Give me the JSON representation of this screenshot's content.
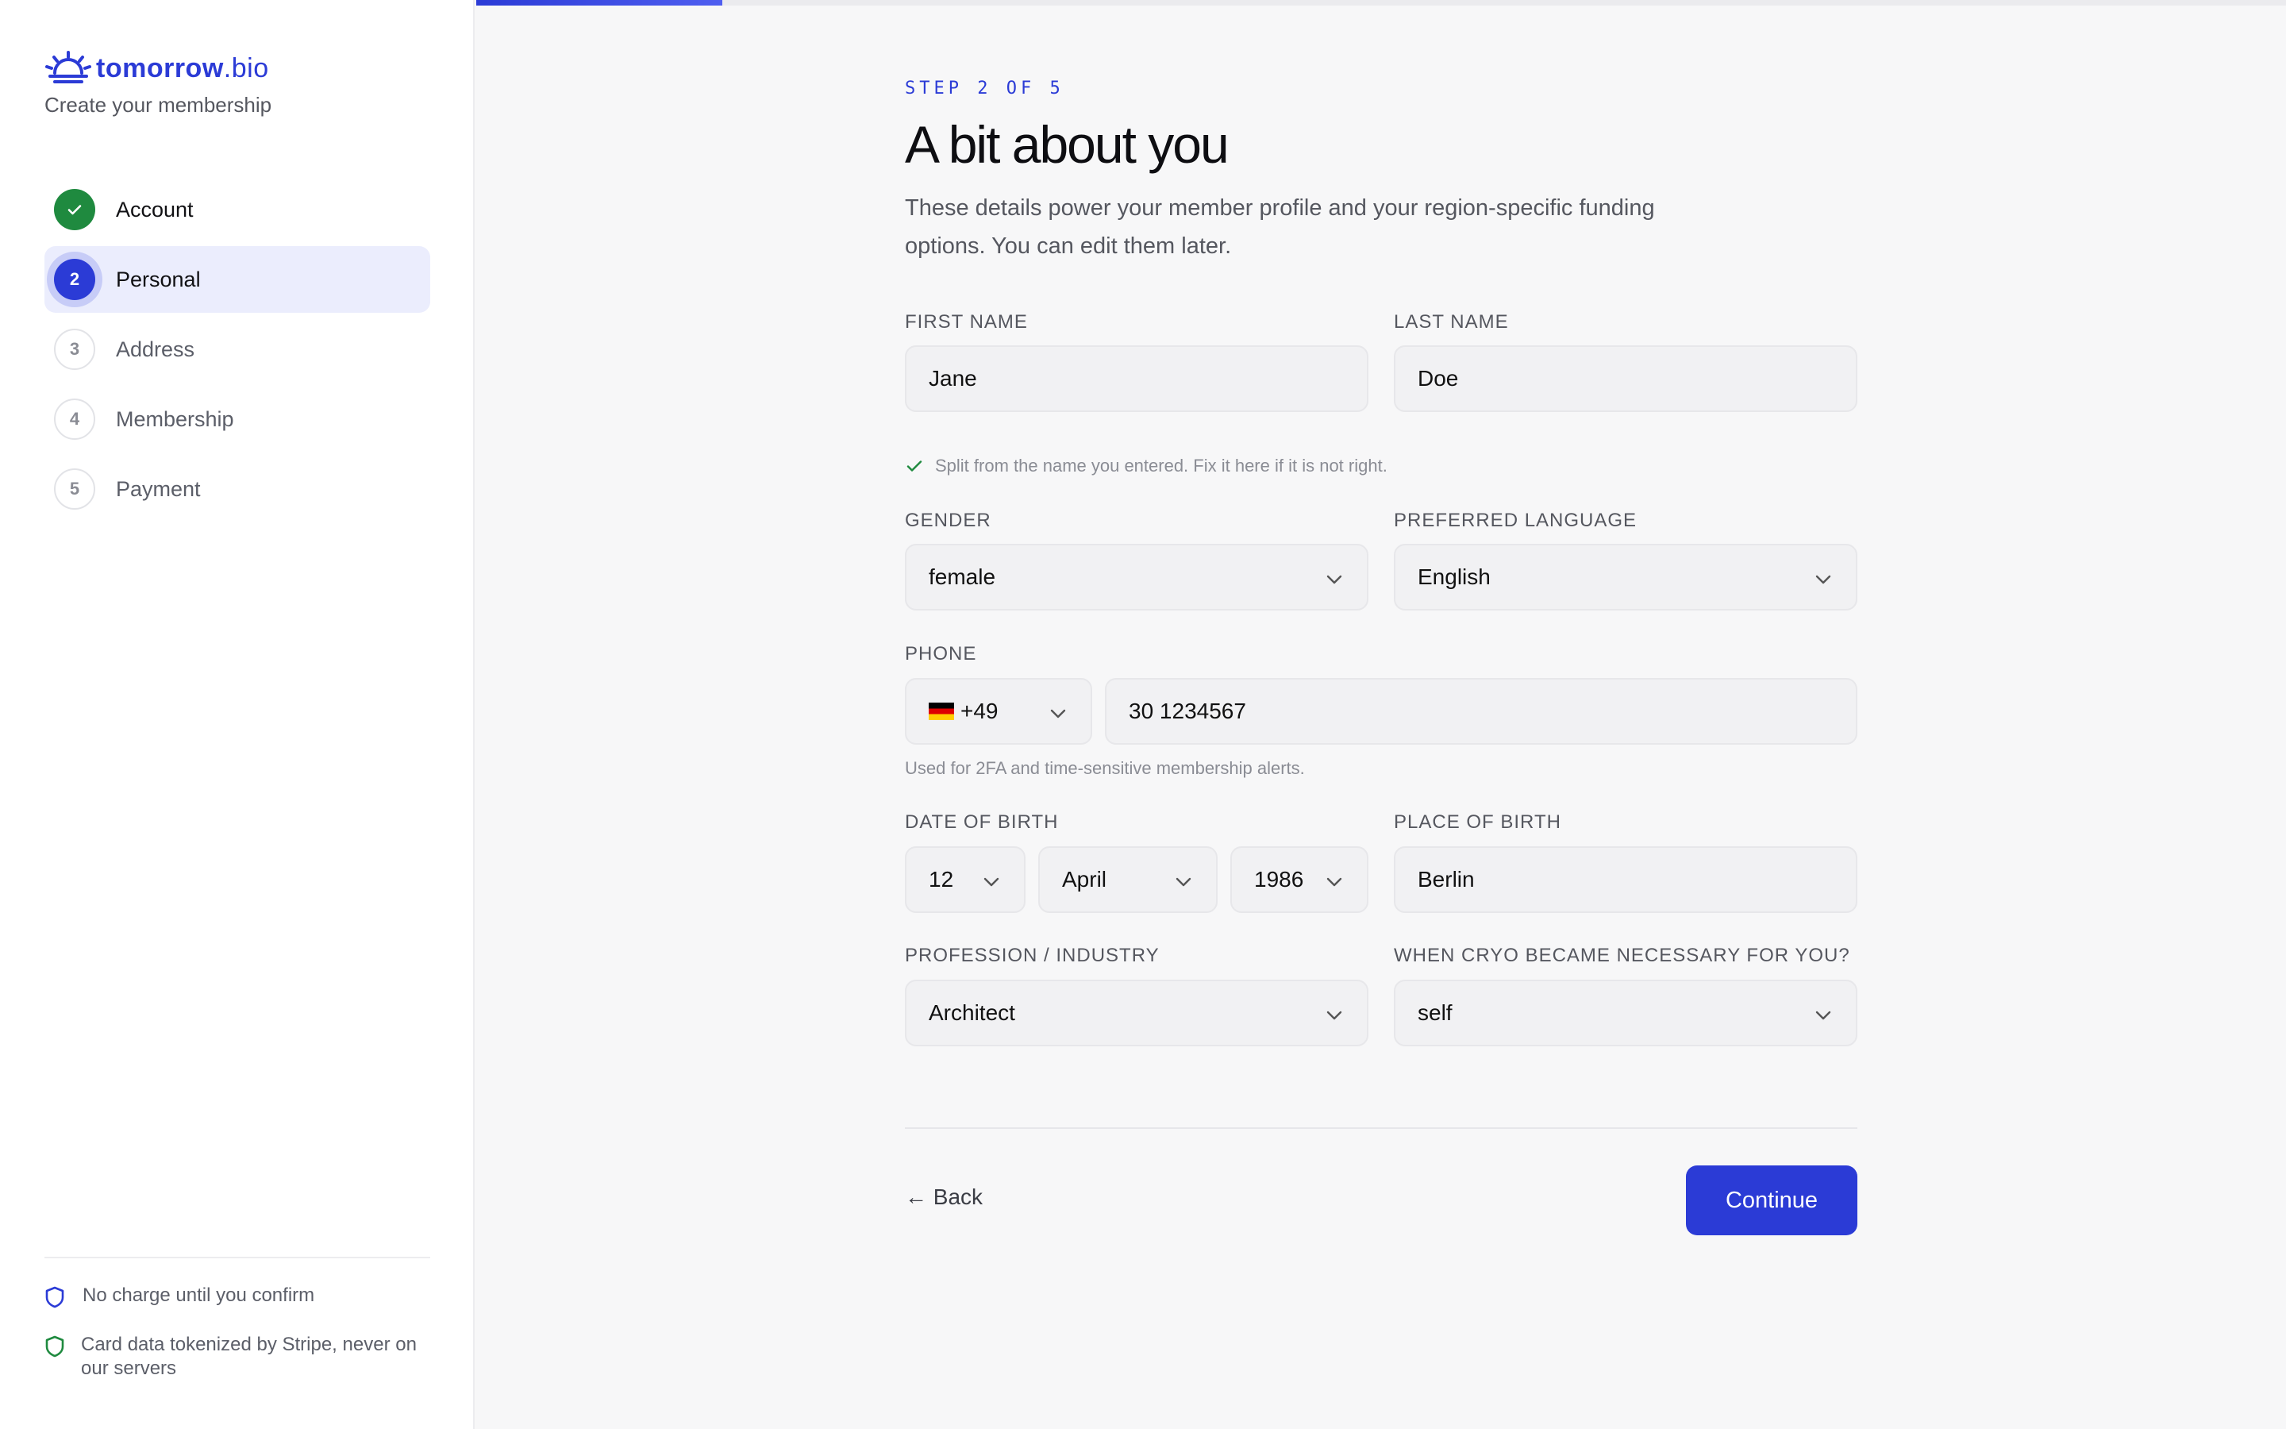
{
  "brand": {
    "name_bold": "tomorrow",
    "name_light": ".bio",
    "subtitle": "Create your membership"
  },
  "progress": {
    "fraction": 0.136
  },
  "steps": [
    {
      "number": "1",
      "label": "Account",
      "state": "done"
    },
    {
      "number": "2",
      "label": "Personal",
      "state": "current"
    },
    {
      "number": "3",
      "label": "Address",
      "state": "todo"
    },
    {
      "number": "4",
      "label": "Membership",
      "state": "todo"
    },
    {
      "number": "5",
      "label": "Payment",
      "state": "todo"
    }
  ],
  "sidebar_notes": [
    {
      "icon": "shield-icon",
      "text": "No charge until you confirm"
    },
    {
      "icon": "shield-check-icon",
      "text": "Card data tokenized by Stripe, never on our servers"
    }
  ],
  "header": {
    "eyebrow": "STEP 2 OF 5",
    "title": "A bit about you",
    "subtitle": "These details power your member profile and your region-specific funding options. You can edit them later."
  },
  "form": {
    "first_name": {
      "label": "FIRST NAME",
      "value": "Jane"
    },
    "last_name": {
      "label": "LAST NAME",
      "value": "Doe"
    },
    "split_note": "Split from the name you entered. Fix it here if it is not right.",
    "gender": {
      "label": "GENDER",
      "value": "female"
    },
    "language": {
      "label": "PREFERRED LANGUAGE",
      "value": "English"
    },
    "phone": {
      "label": "PHONE",
      "country_code": "+49",
      "number": "30 1234567",
      "helper": "Used for 2FA and time-sensitive membership alerts."
    },
    "dob": {
      "label": "DATE OF BIRTH",
      "day": "12",
      "month": "April",
      "year": "1986"
    },
    "pob": {
      "label": "PLACE OF BIRTH",
      "value": "Berlin"
    },
    "profession": {
      "label": "PROFESSION / INDUSTRY",
      "value": "Architect"
    },
    "cryo": {
      "label": "WHEN CRYO BECAME NECESSARY FOR YOU?",
      "value": "self"
    }
  },
  "actions": {
    "back": "← Back",
    "continue": "Continue"
  },
  "colors": {
    "accent": "#2b3bd6",
    "success": "#1f8a3f"
  }
}
